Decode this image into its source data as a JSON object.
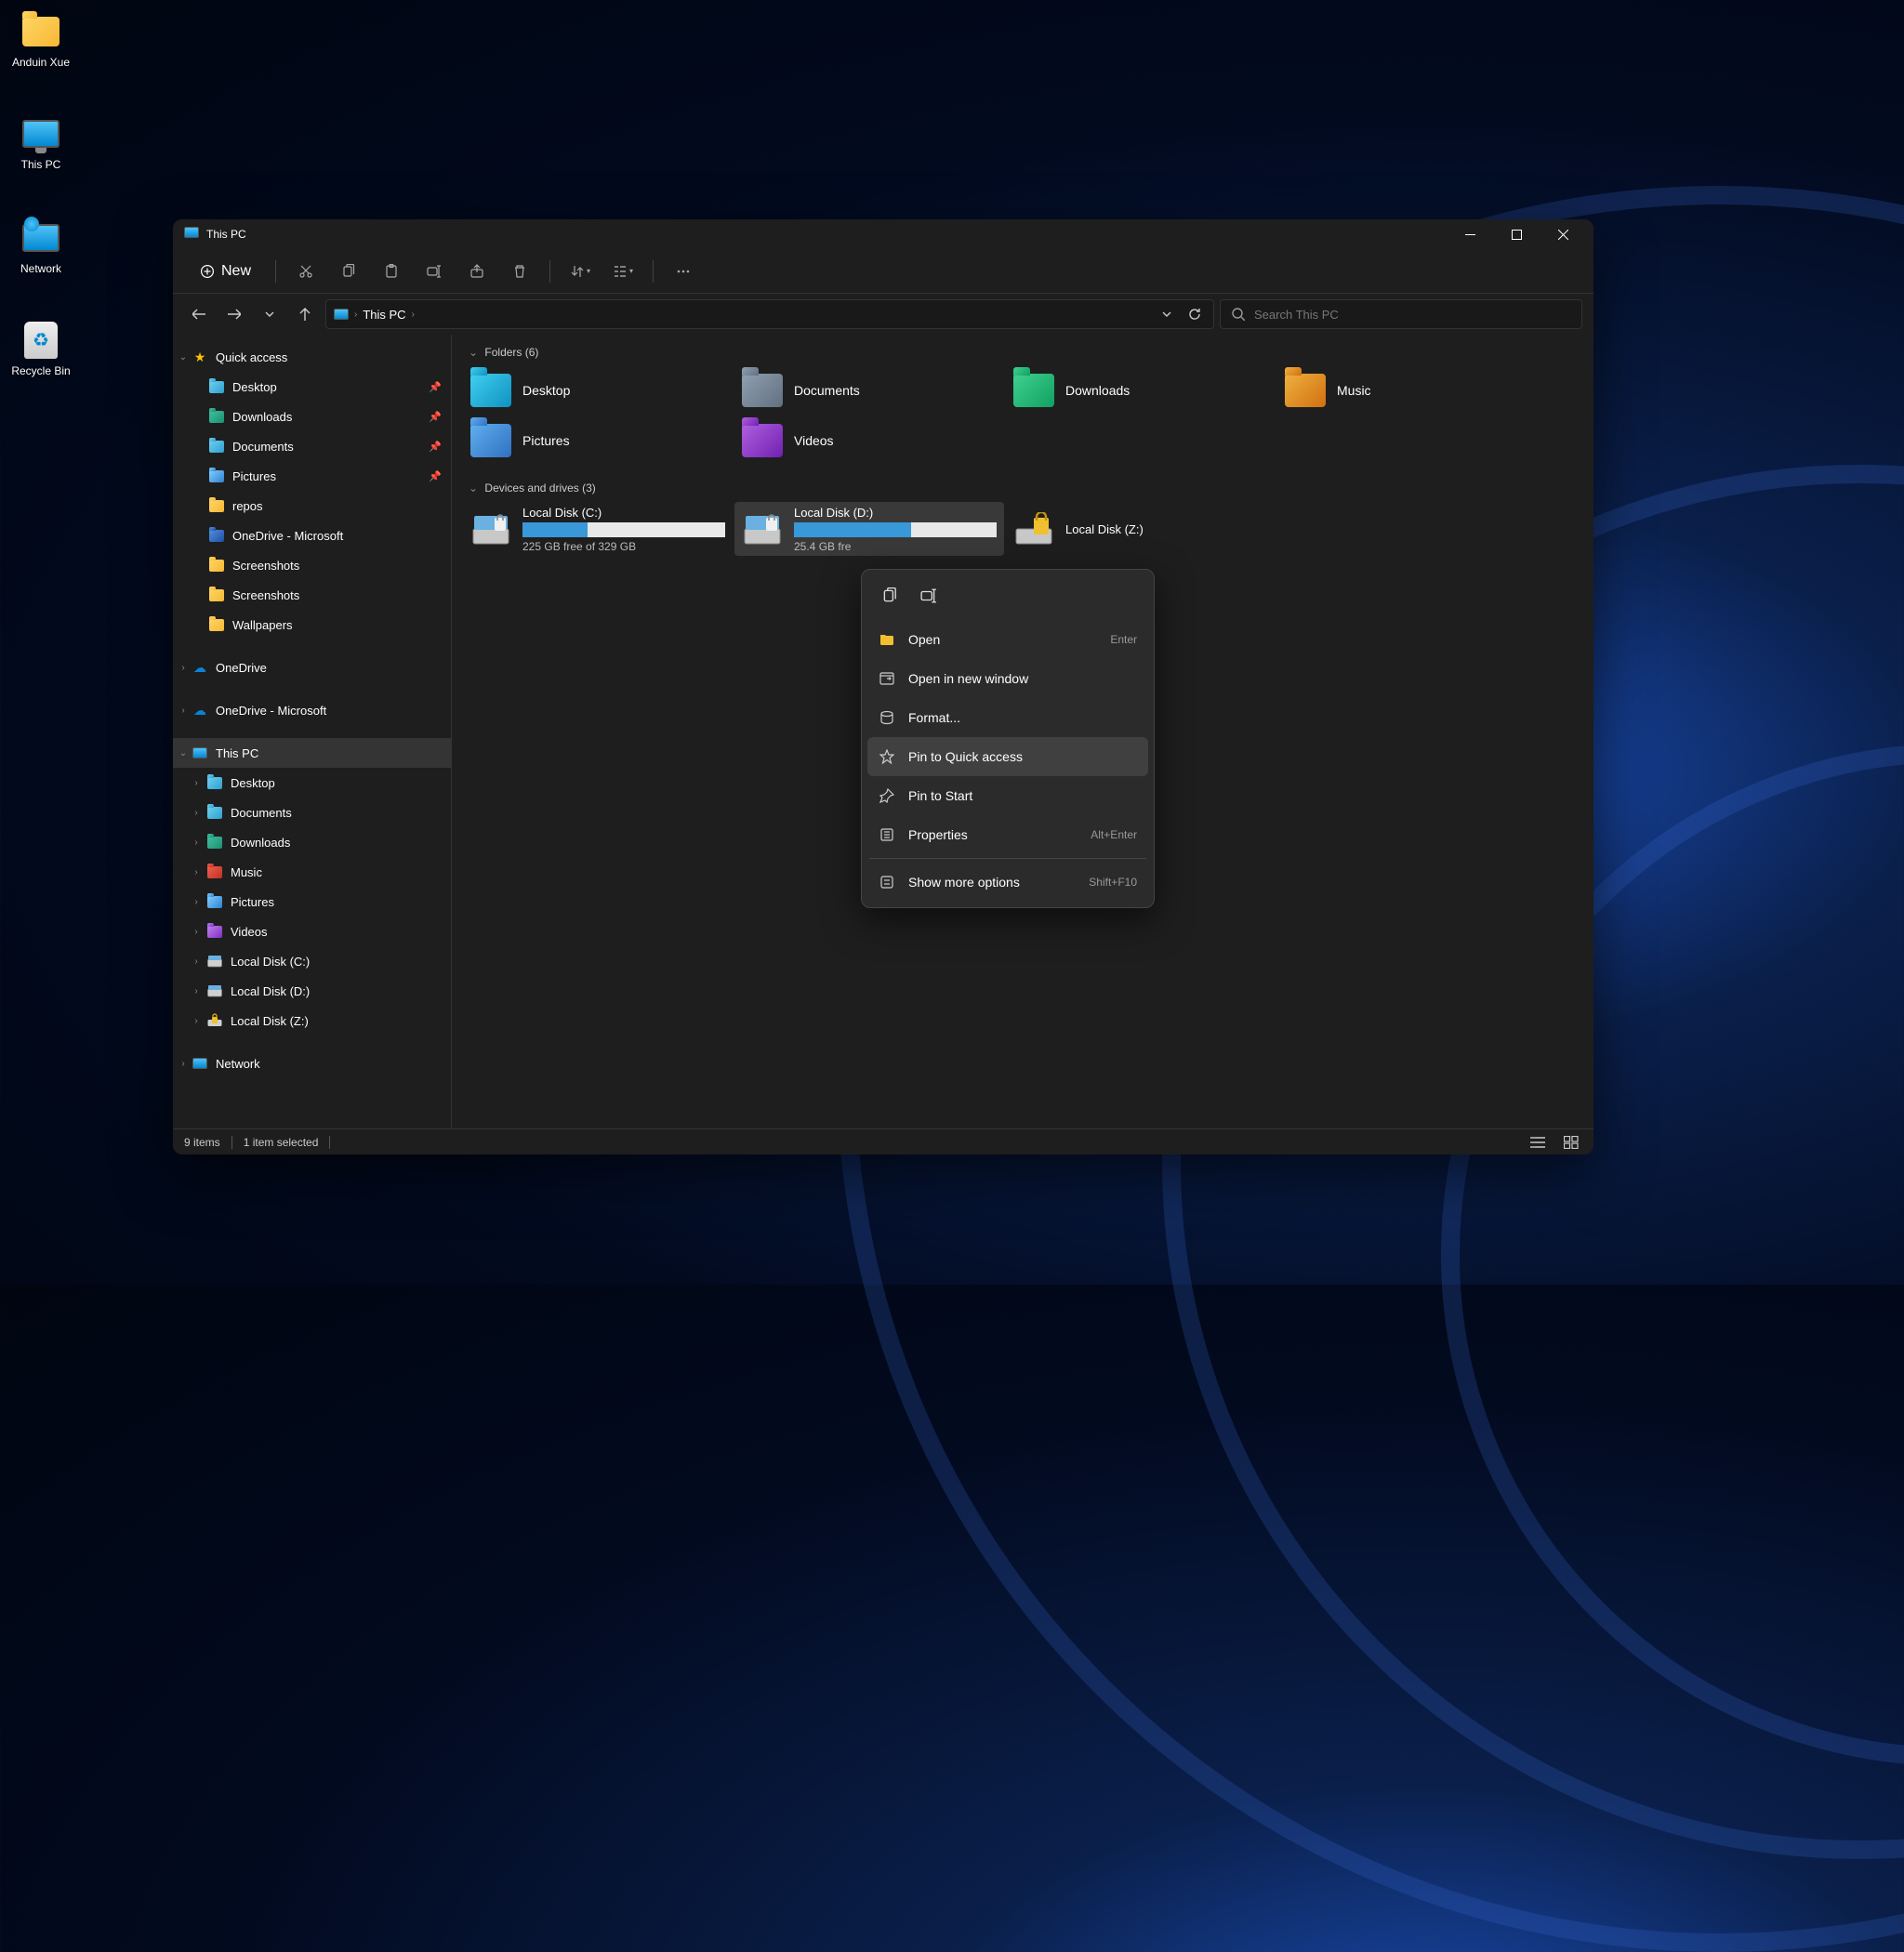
{
  "desktop": {
    "icons": [
      {
        "label": "Anduin Xue",
        "kind": "folder"
      },
      {
        "label": "This PC",
        "kind": "pc"
      },
      {
        "label": "Network",
        "kind": "network"
      },
      {
        "label": "Recycle Bin",
        "kind": "recycle"
      }
    ]
  },
  "window": {
    "title": "This PC",
    "toolbar": {
      "new_label": "New"
    },
    "address": {
      "segment": "This PC"
    },
    "search": {
      "placeholder": "Search This PC"
    },
    "sidebar": {
      "quick_access": "Quick access",
      "quick_items": [
        {
          "label": "Desktop",
          "pinned": true,
          "color": "blue"
        },
        {
          "label": "Downloads",
          "pinned": true,
          "color": "teal"
        },
        {
          "label": "Documents",
          "pinned": true,
          "color": "blue"
        },
        {
          "label": "Pictures",
          "pinned": true,
          "color": "sky"
        },
        {
          "label": "repos",
          "pinned": false,
          "color": "yellow"
        },
        {
          "label": "OneDrive - Microsoft",
          "pinned": false,
          "color": "darkblue"
        },
        {
          "label": "Screenshots",
          "pinned": false,
          "color": "yellow"
        },
        {
          "label": "Screenshots",
          "pinned": false,
          "color": "yellow"
        },
        {
          "label": "Wallpapers",
          "pinned": false,
          "color": "yellow"
        }
      ],
      "onedrive": "OneDrive",
      "onedrive_ms": "OneDrive - Microsoft",
      "this_pc": "This PC",
      "pc_items": [
        {
          "label": "Desktop",
          "color": "blue"
        },
        {
          "label": "Documents",
          "color": "blue"
        },
        {
          "label": "Downloads",
          "color": "teal"
        },
        {
          "label": "Music",
          "color": "red"
        },
        {
          "label": "Pictures",
          "color": "sky"
        },
        {
          "label": "Videos",
          "color": "purple"
        },
        {
          "label": "Local Disk (C:)"
        },
        {
          "label": "Local Disk (D:)"
        },
        {
          "label": "Local Disk (Z:)"
        }
      ],
      "network": "Network"
    },
    "content": {
      "folders_header": "Folders (6)",
      "folders": [
        {
          "label": "Desktop",
          "color": "cyan"
        },
        {
          "label": "Documents",
          "color": "grey"
        },
        {
          "label": "Downloads",
          "color": "green"
        },
        {
          "label": "Music",
          "color": "orange"
        },
        {
          "label": "Pictures",
          "color": "sky"
        },
        {
          "label": "Videos",
          "color": "purple"
        }
      ],
      "drives_header": "Devices and drives (3)",
      "drives": [
        {
          "label": "Local Disk (C:)",
          "sub": "225 GB free of 329 GB",
          "fill": 32,
          "selected": false,
          "locked": false
        },
        {
          "label": "Local Disk (D:)",
          "sub": "25.4 GB fre",
          "fill": 58,
          "selected": true,
          "locked": false
        },
        {
          "label": "Local Disk (Z:)",
          "sub": "",
          "fill": 0,
          "selected": false,
          "locked": true
        }
      ]
    },
    "context_menu": {
      "items": [
        {
          "label": "Open",
          "shortcut": "Enter",
          "icon": "folder"
        },
        {
          "label": "Open in new window",
          "shortcut": "",
          "icon": "window"
        },
        {
          "label": "Format...",
          "shortcut": "",
          "icon": "format"
        },
        {
          "label": "Pin to Quick access",
          "shortcut": "",
          "icon": "star",
          "highlighted": true
        },
        {
          "label": "Pin to Start",
          "shortcut": "",
          "icon": "pin"
        },
        {
          "label": "Properties",
          "shortcut": "Alt+Enter",
          "icon": "props"
        }
      ],
      "more": {
        "label": "Show more options",
        "shortcut": "Shift+F10"
      }
    },
    "status": {
      "items": "9 items",
      "selected": "1 item selected"
    }
  }
}
